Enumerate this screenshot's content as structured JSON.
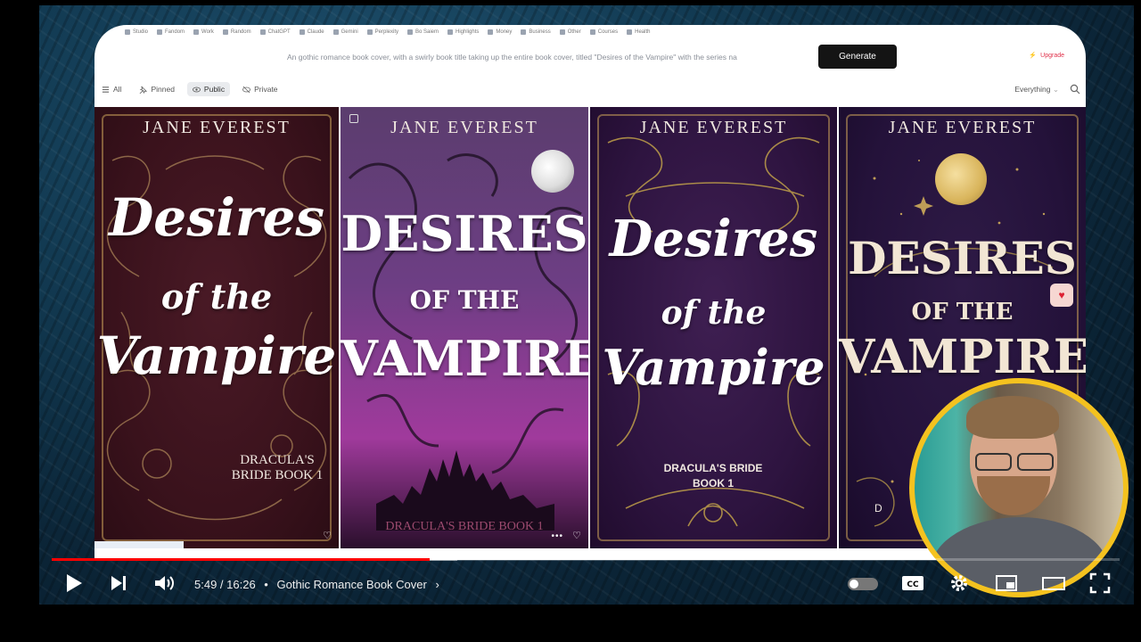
{
  "browser": {
    "bookmarks": [
      "Studio",
      "Fandom",
      "Work",
      "Random",
      "ChatGPT",
      "Claude",
      "Gemini",
      "Perplexity",
      "Bo Saiem",
      "Highlights",
      "Money",
      "Business",
      "Other",
      "Courses",
      "Health"
    ]
  },
  "generator": {
    "prompt": "An gothic romance book cover, with a swirly book title taking up the entire book cover, titled \"Desires of the Vampire\" with the series na",
    "generate_label": "Generate",
    "upgrade_label": "Upgrade"
  },
  "filters": {
    "all": "All",
    "pinned": "Pinned",
    "public": "Public",
    "private": "Private",
    "everything": "Everything"
  },
  "books": [
    {
      "author": "JANE EVEREST",
      "t1": "Desires",
      "t2": "of the",
      "t3": "Vampire",
      "series": "DRACULA'S BRIDE BOOK 1"
    },
    {
      "author": "JANE EVEREST",
      "t1": "DESIRES",
      "t2": "OF THE",
      "t3": "VAMPIRE",
      "series": "DRACULA'S BRIDE BOOK 1"
    },
    {
      "author": "JANE EVEREST",
      "t1": "Desires",
      "t2": "of the",
      "t3": "Vampire",
      "series": "DRACULA'S BRIDE BOOK 1"
    },
    {
      "author": "JANE EVEREST",
      "t1": "DESIRES",
      "t2": "OF THE",
      "t3": "VAMPIRE",
      "series": "D"
    }
  ],
  "player": {
    "time": "5:49 / 16:26",
    "separator": "•",
    "chapter": "Gothic Romance Book Cover",
    "chapter_chevron": "›",
    "progress_fraction": 0.354,
    "buffered_fraction": 0.38
  },
  "colors": {
    "played": "#ff0000",
    "webcam_ring": "#f4c21f"
  }
}
